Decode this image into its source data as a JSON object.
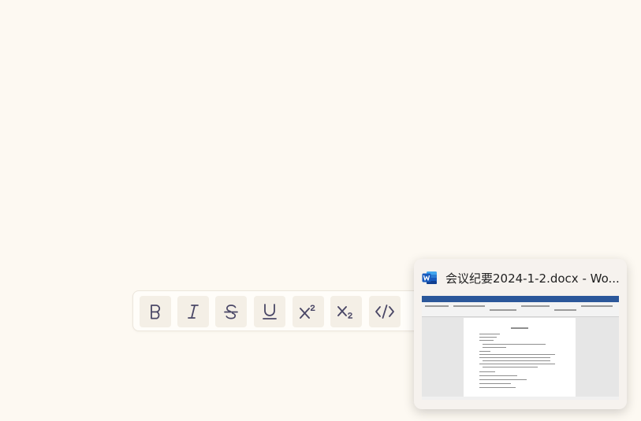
{
  "toolbar": {
    "buttons": [
      {
        "name": "bold-button",
        "icon": "bold-icon"
      },
      {
        "name": "italic-button",
        "icon": "italic-icon"
      },
      {
        "name": "strikethrough-button",
        "icon": "strikethrough-icon"
      },
      {
        "name": "underline-button",
        "icon": "underline-icon"
      },
      {
        "name": "superscript-button",
        "icon": "superscript-icon"
      },
      {
        "name": "subscript-button",
        "icon": "subscript-icon"
      },
      {
        "name": "code-button",
        "icon": "code-icon"
      }
    ],
    "icon_color": "#4a4766",
    "button_bg": "#f4efe6"
  },
  "taskbar_preview": {
    "app_icon": "word-icon",
    "title": "会议纪要2024-1-2.docx - Wo...",
    "brand_color": "#2b579a"
  }
}
